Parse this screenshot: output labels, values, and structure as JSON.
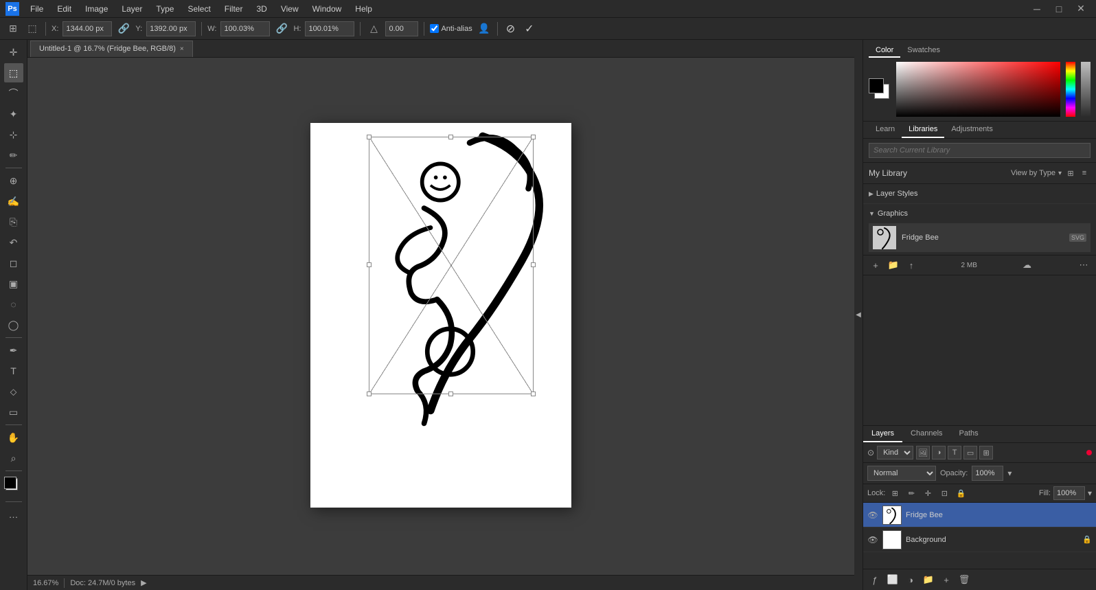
{
  "app": {
    "logo": "Ps",
    "title": "Untitled-1 @ 16.7% (Fridge Bee, RGB/8)",
    "tab_close": "×"
  },
  "menu": {
    "items": [
      "File",
      "Edit",
      "Image",
      "Layer",
      "Type",
      "Select",
      "Filter",
      "3D",
      "View",
      "Window",
      "Help"
    ]
  },
  "options_bar": {
    "x_label": "X:",
    "x_value": "1344.00 px",
    "y_label": "Y:",
    "y_value": "1392.00 px",
    "w_label": "W:",
    "w_value": "100.03%",
    "h_label": "H:",
    "h_value": "100.01%",
    "angle_value": "0.00",
    "anti_alias_label": "Anti-alias",
    "anti_alias_checked": true,
    "cancel_symbol": "⊘",
    "confirm_symbol": "✓"
  },
  "tab": {
    "label": "Untitled-1 @ 16.7% (Fridge Bee, RGB/8)"
  },
  "status_bar": {
    "zoom": "16.67%",
    "doc_size": "Doc: 24.7M/0 bytes",
    "arrow": "▶"
  },
  "color_panel": {
    "tabs": [
      "Color",
      "Swatches"
    ]
  },
  "libraries_panel": {
    "tabs": [
      "Learn",
      "Libraries",
      "Adjustments"
    ],
    "active_tab": "Libraries",
    "search_placeholder": "Search Current Library",
    "my_library": "My Library",
    "view_by_type": "View by Type",
    "layer_styles_label": "Layer Styles",
    "graphics_label": "Graphics",
    "graphics_item_name": "Fridge Bee",
    "graphics_item_badge": "SVG",
    "lib_size": "2 MB",
    "add_icon": "+",
    "folder_icon": "📁",
    "upload_icon": "↑"
  },
  "layers_panel": {
    "tabs": [
      "Layers",
      "Channels",
      "Paths"
    ],
    "active_tab": "Layers",
    "filter_label": "Kind",
    "blend_mode": "Normal",
    "opacity_label": "Opacity:",
    "opacity_value": "100%",
    "lock_label": "Lock:",
    "fill_label": "Fill:",
    "fill_value": "100%",
    "layers": [
      {
        "name": "Fridge Bee",
        "visible": true,
        "is_active": true,
        "has_lock": false,
        "type": "smart"
      },
      {
        "name": "Background",
        "visible": true,
        "is_active": false,
        "has_lock": true,
        "type": "normal"
      }
    ]
  },
  "tools": [
    {
      "name": "move-tool",
      "icon": "✛",
      "title": "Move"
    },
    {
      "name": "selection-tool",
      "icon": "⬚",
      "title": "Rectangular Marquee"
    },
    {
      "name": "lasso-tool",
      "icon": "⌒",
      "title": "Lasso"
    },
    {
      "name": "quick-select-tool",
      "icon": "⬡",
      "title": "Quick Select"
    },
    {
      "name": "crop-tool",
      "icon": "⊹",
      "title": "Crop"
    },
    {
      "name": "eyedropper-tool",
      "icon": "✏",
      "title": "Eyedropper"
    },
    {
      "name": "healing-tool",
      "icon": "⊕",
      "title": "Healing Brush"
    },
    {
      "name": "brush-tool",
      "icon": "✍",
      "title": "Brush"
    },
    {
      "name": "clone-tool",
      "icon": "⎘",
      "title": "Clone Stamp"
    },
    {
      "name": "history-tool",
      "icon": "↶",
      "title": "History Brush"
    },
    {
      "name": "eraser-tool",
      "icon": "◻",
      "title": "Eraser"
    },
    {
      "name": "gradient-tool",
      "icon": "▣",
      "title": "Gradient"
    },
    {
      "name": "blur-tool",
      "icon": "◌",
      "title": "Blur"
    },
    {
      "name": "dodge-tool",
      "icon": "◯",
      "title": "Dodge"
    },
    {
      "name": "pen-tool",
      "icon": "✒",
      "title": "Pen"
    },
    {
      "name": "type-tool",
      "icon": "T",
      "title": "Type"
    },
    {
      "name": "path-selection-tool",
      "icon": "⬦",
      "title": "Path Selection"
    },
    {
      "name": "shape-tool",
      "icon": "▭",
      "title": "Shape"
    },
    {
      "name": "hand-tool",
      "icon": "✋",
      "title": "Hand"
    },
    {
      "name": "zoom-tool",
      "icon": "⌕",
      "title": "Zoom"
    },
    {
      "name": "more-tools",
      "icon": "…",
      "title": "More Tools"
    }
  ]
}
